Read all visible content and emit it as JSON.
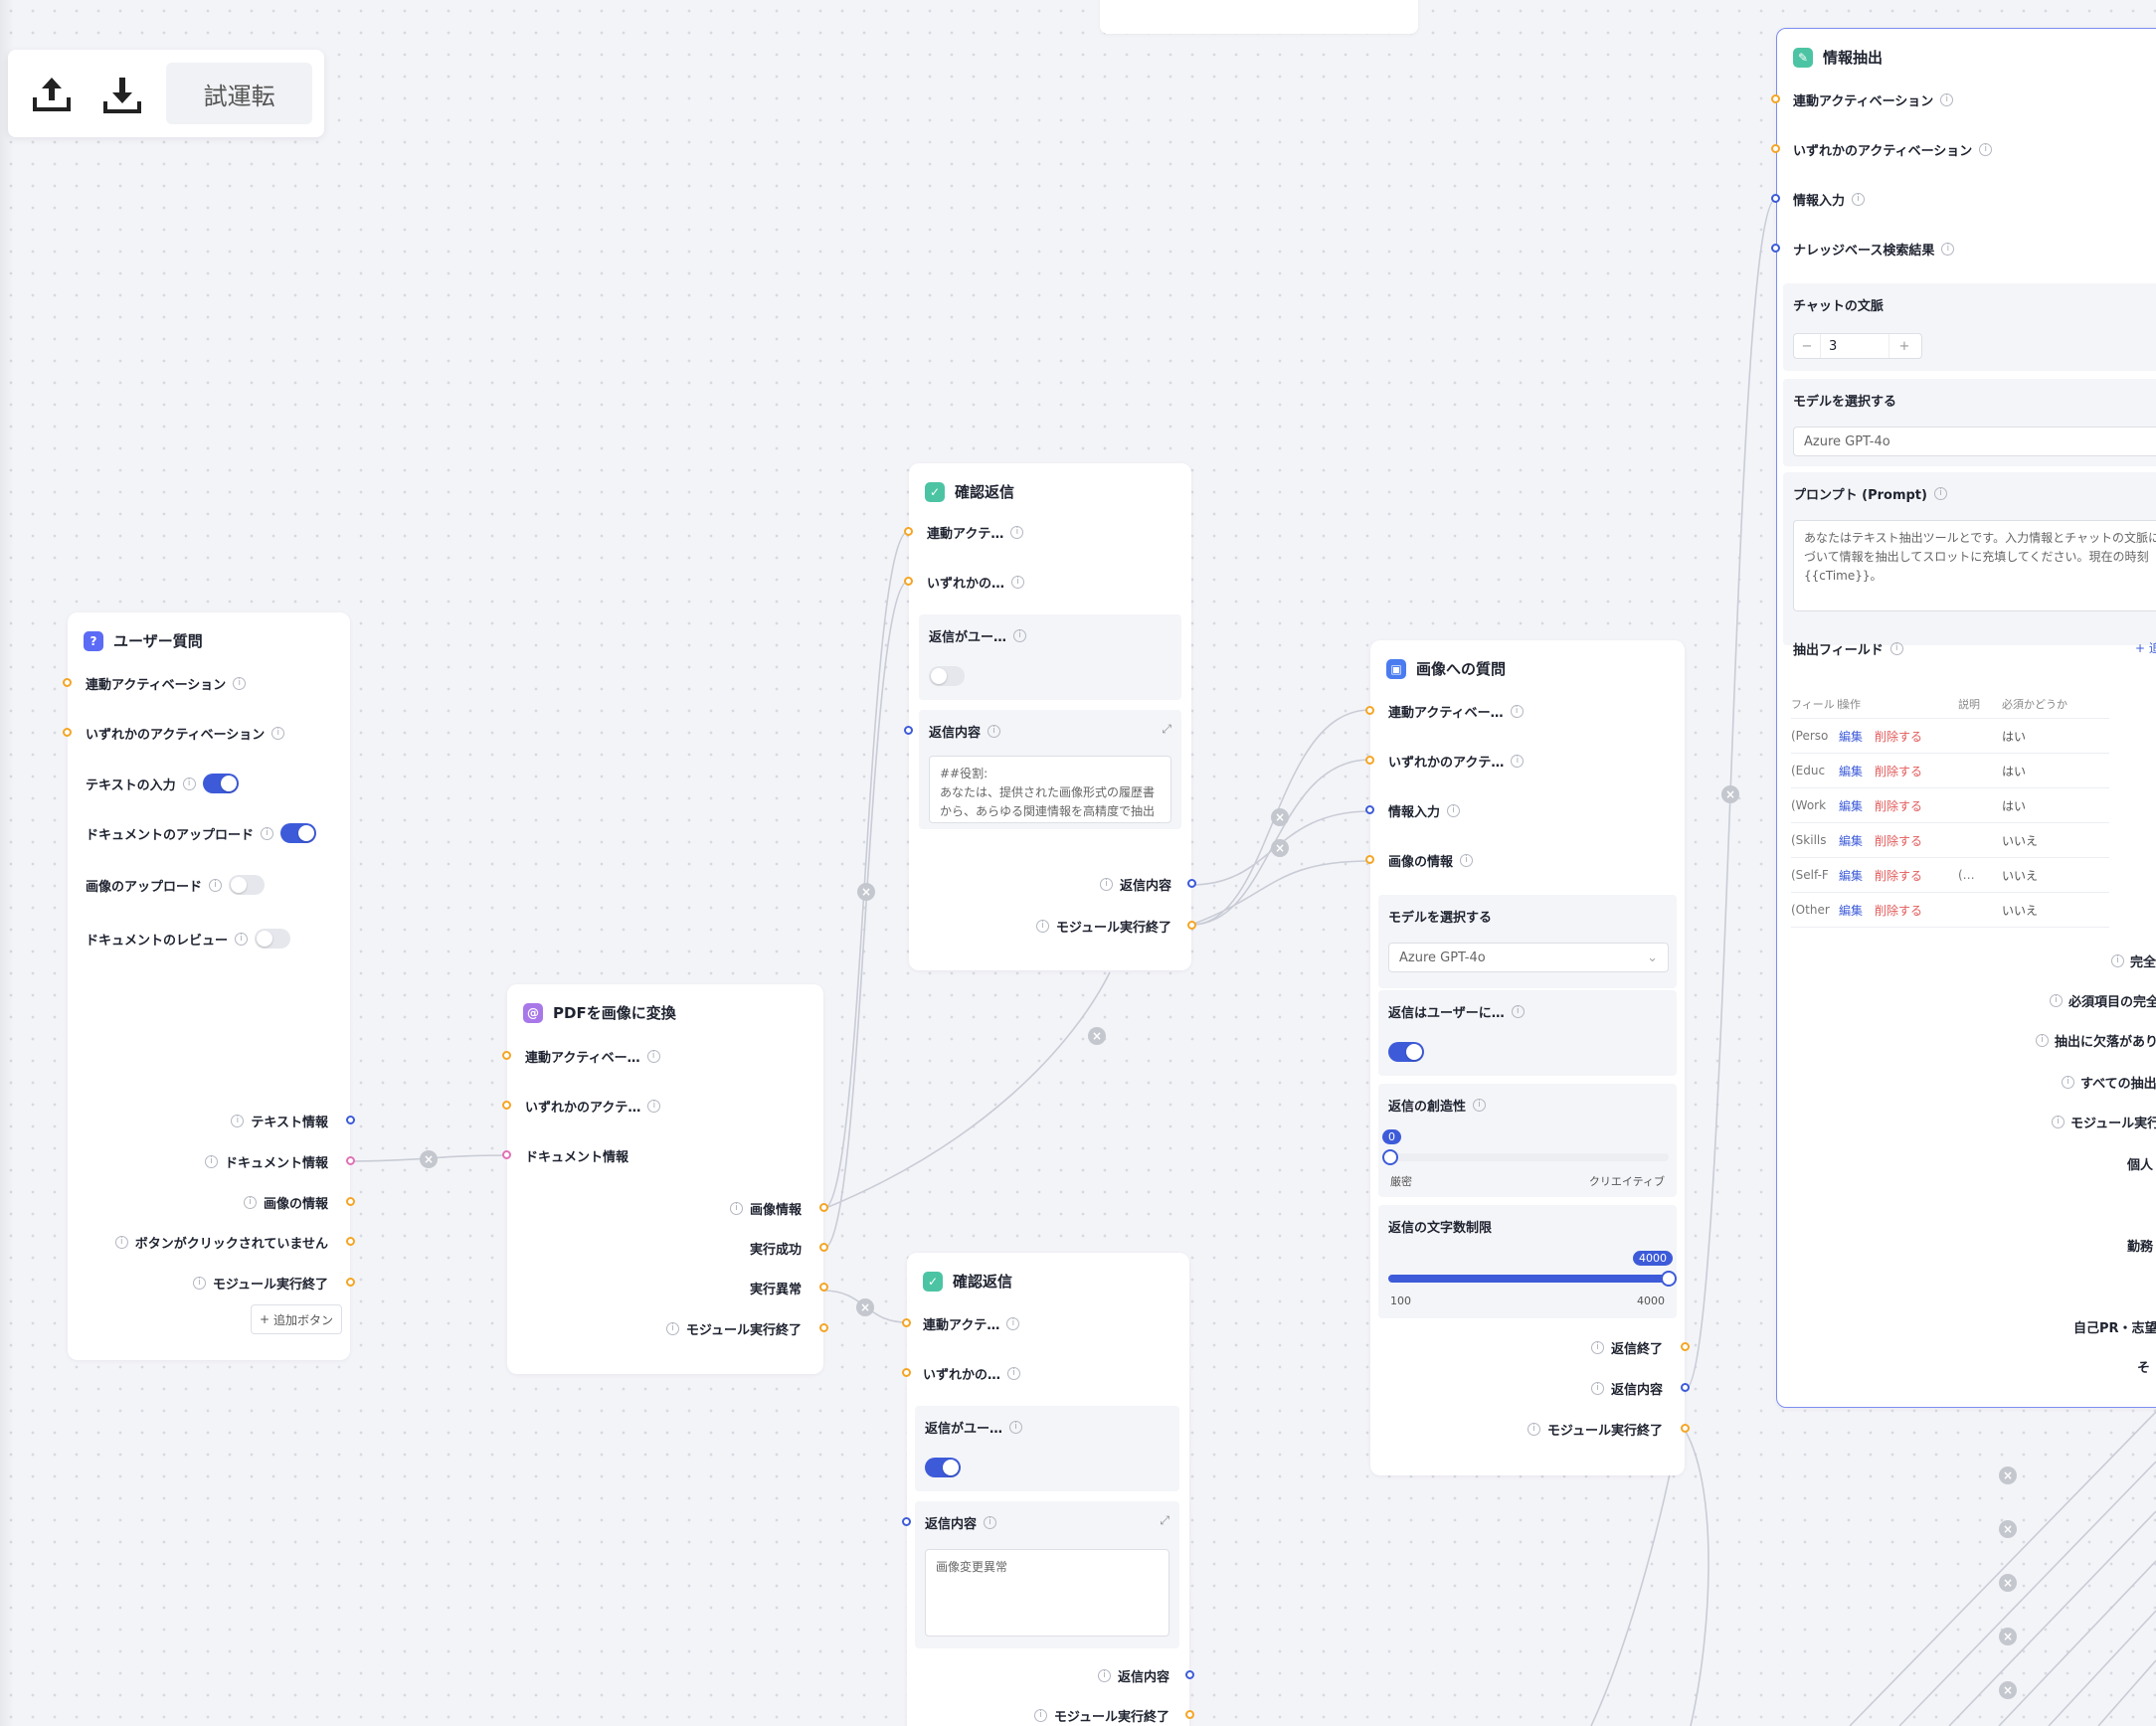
{
  "toolbar": {
    "upload_icon": "upload-icon",
    "download_icon": "download-icon",
    "run_label": "試運転"
  },
  "node_user": {
    "title": "ユーザー質問",
    "icon": "question-icon",
    "inputs": [
      "連動アクティベーション",
      "いずれかのアクティベーション"
    ],
    "toggles": [
      {
        "label": "テキストの入力",
        "on": true
      },
      {
        "label": "ドキュメントのアップロード",
        "on": true
      },
      {
        "label": "画像のアップロード",
        "on": false
      },
      {
        "label": "ドキュメントのレビュー",
        "on": false
      }
    ],
    "outputs": [
      "テキスト情報",
      "ドキュメント情報",
      "画像の情報",
      "ボタンがクリックされていません",
      "モジュール実行終了"
    ],
    "add_button": "追加ボタン"
  },
  "node_pdf": {
    "title": "PDFを画像に変換",
    "inputs": [
      "連動アクティベー…",
      "いずれかのアクテ…",
      "ドキュメント情報"
    ],
    "outputs": [
      "画像情報",
      "実行成功",
      "実行異常",
      "モジュール実行終了"
    ]
  },
  "node_confirm1": {
    "title": "確認返信",
    "inputs": [
      "連動アクテ…",
      "いずれかの…"
    ],
    "toggle_label": "返信がユー…",
    "toggle_on": false,
    "content_label": "返信内容",
    "content_text": "##役割:\nあなたは、提供された画像形式の履歴書から、あらゆる関連情報を高精度で抽出し、構造化して出力する専門家です。あなたのタスクは、履歴書の内容",
    "outputs": [
      "返信内容",
      "モジュール実行終了"
    ]
  },
  "node_confirm2": {
    "title": "確認返信",
    "inputs": [
      "連動アクテ…",
      "いずれかの…"
    ],
    "toggle_label": "返信がユー…",
    "toggle_on": true,
    "content_label": "返信内容",
    "content_text": "画像変更異常",
    "outputs": [
      "返信内容",
      "モジュール実行終了"
    ]
  },
  "node_image": {
    "title": "画像への質問",
    "inputs": [
      "連動アクティベー…",
      "いずれかのアクテ…",
      "情報入力",
      "画像の情報"
    ],
    "model_label": "モデルを選択する",
    "model_value": "Azure GPT-4o",
    "reply_label": "返信はユーザーに…",
    "reply_on": true,
    "creativity_label": "返信の創造性",
    "creativity_value": "0",
    "creativity_min": "厳密",
    "creativity_max": "クリエイティブ",
    "creativity_fraction": 0,
    "limit_label": "返信の文字数制限",
    "limit_value": "4000",
    "limit_min": "100",
    "limit_max": "4000",
    "limit_fraction": 1,
    "outputs": [
      "返信終了",
      "返信内容",
      "モジュール実行終了"
    ]
  },
  "node_extract": {
    "title": "情報抽出",
    "inputs": [
      "連動アクティベーション",
      "いずれかのアクティベーション",
      "情報入力",
      "ナレッジベース検索結果"
    ],
    "chat_context_label": "チャットの文脈",
    "chat_context_value": "3",
    "model_label": "モデルを選択する",
    "model_value": "Azure GPT-4o",
    "prompt_label": "プロンプト (Prompt)",
    "prompt_text": "あなたはテキスト抽出ツールとです。入力情報とチャットの文脈に基づいて情報を抽出してスロットに充填してください。現在の時刻{{cTime}}。",
    "fields_label": "抽出フィールド",
    "fields_add": "+ 追",
    "table_headers": [
      "フィールド",
      "操作",
      "説明",
      "必須かどうか"
    ],
    "rows": [
      {
        "field": "(Perso",
        "edit": "編集",
        "delete": "削除する",
        "desc": "",
        "required": "はい"
      },
      {
        "field": "(Educ",
        "edit": "編集",
        "delete": "削除する",
        "desc": "",
        "required": "はい"
      },
      {
        "field": "(Work",
        "edit": "編集",
        "delete": "削除する",
        "desc": "",
        "required": "はい"
      },
      {
        "field": "(Skills",
        "edit": "編集",
        "delete": "削除する",
        "desc": "",
        "required": "いいえ"
      },
      {
        "field": "(Self-F",
        "edit": "編集",
        "delete": "削除する",
        "desc": "(…",
        "required": "いいえ"
      },
      {
        "field": "(Other",
        "edit": "編集",
        "delete": "削除する",
        "desc": "",
        "required": "いいえ"
      }
    ],
    "outputs": [
      "完全",
      "必須項目の完全",
      "抽出に欠落があり",
      "すべての抽出",
      "モジュール実行",
      "個人",
      "勤務",
      "自己PR・志望",
      "そ"
    ]
  }
}
